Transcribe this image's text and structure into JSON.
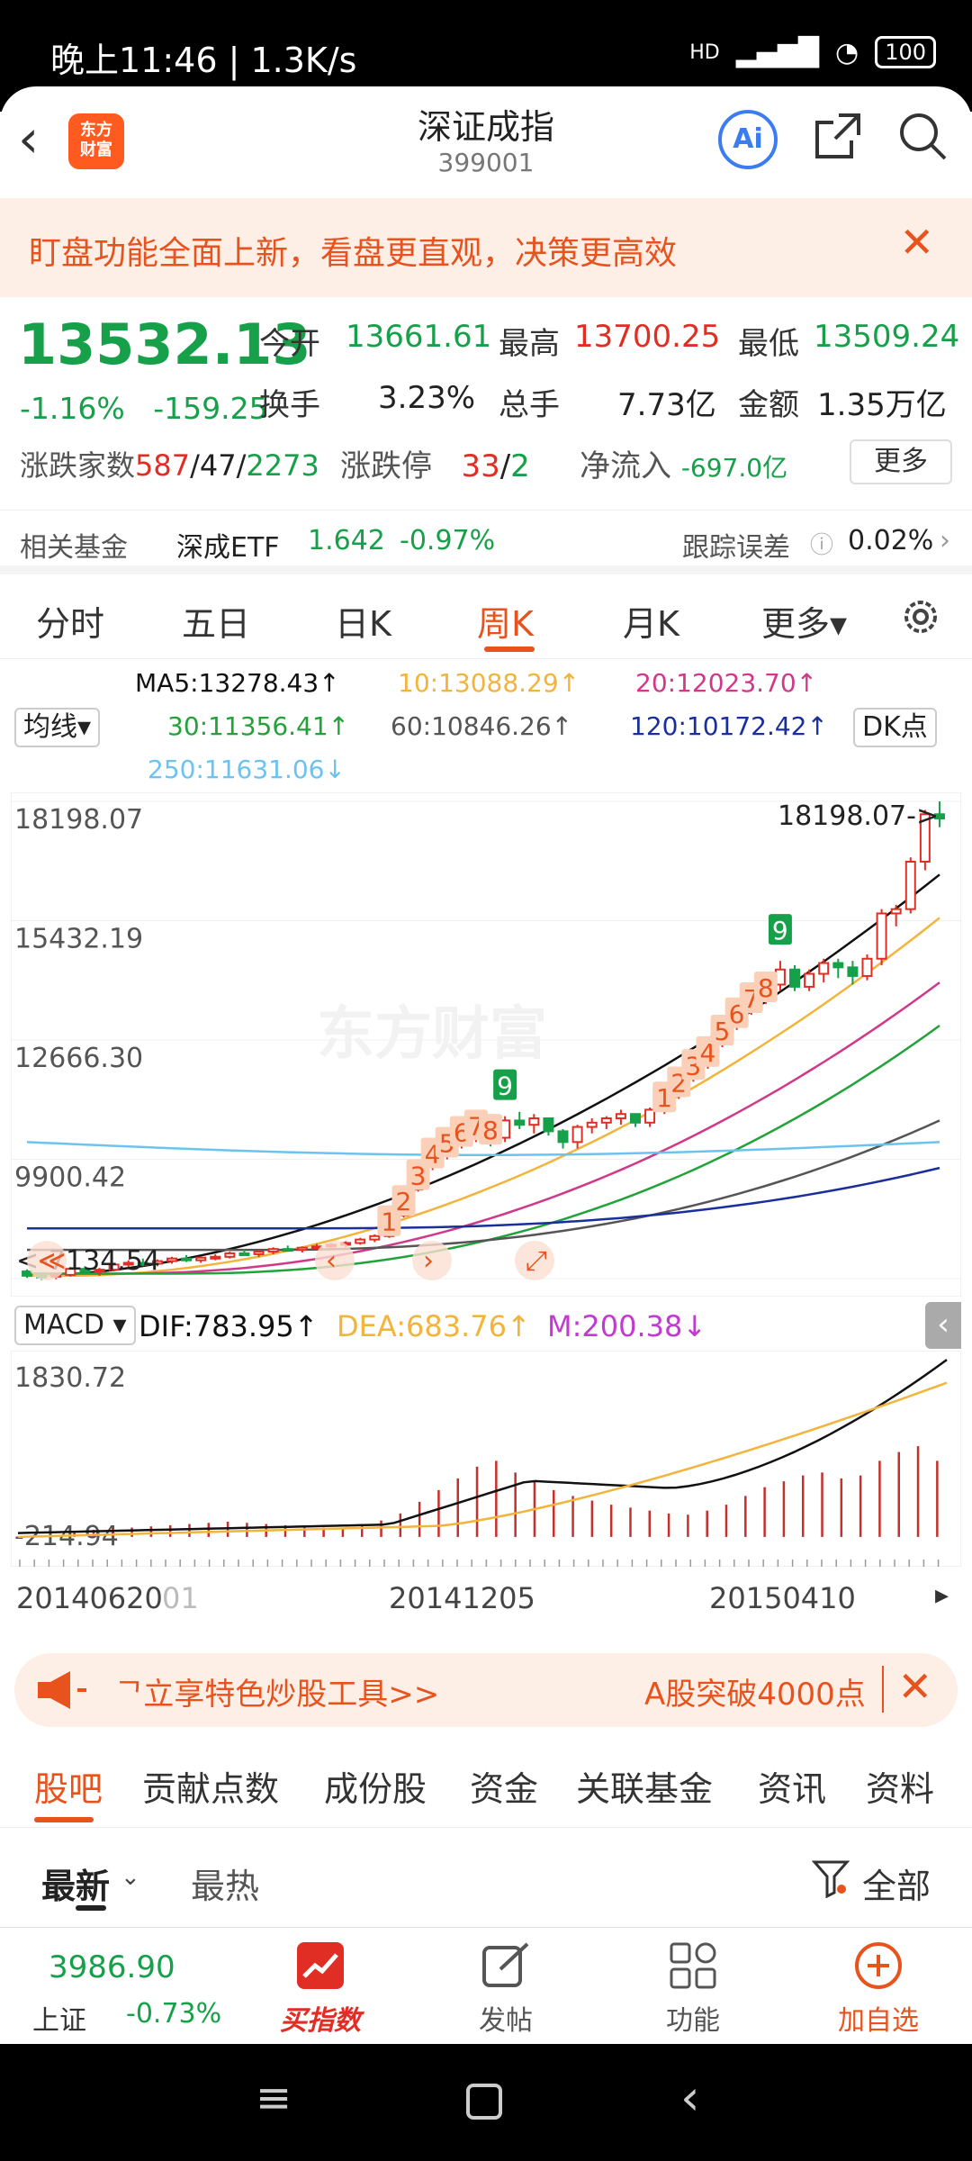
{
  "status_bar": {
    "time": "晚上11:46 | 1.3K/s",
    "battery": "100",
    "net": "HD"
  },
  "header": {
    "back": "‹",
    "logo_text": "东方\n财富",
    "title": "深证成指",
    "code": "399001",
    "ai_label": "Ai"
  },
  "banner": {
    "text": "盯盘功能全面上新，看盘更直观，决策更高效",
    "close": "✕"
  },
  "quote": {
    "price": "13532.13",
    "change_pct": "-1.16%",
    "change_abs": "-159.25",
    "open_label": "今开",
    "open": "13661.61",
    "high_label": "最高",
    "high": "13700.25",
    "low_label": "最低",
    "low": "13509.24",
    "turnover_label": "换手",
    "turnover": "3.23%",
    "volume_label": "总手",
    "volume": "7.73亿",
    "amount_label": "金额",
    "amount": "1.35万亿",
    "breadth_label": "涨跌家数",
    "up_count": "587",
    "sep1": "/",
    "flat_count": "47",
    "sep2": "/",
    "down_count": "2273",
    "limit_label": "涨跌停",
    "limit_up": "33",
    "sep3": "/",
    "limit_down": "2",
    "netflow_label": "净流入",
    "netflow": "-697.0亿",
    "more": "更多"
  },
  "fund": {
    "label": "相关基金",
    "name": "深成ETF",
    "price": "1.642",
    "pct": "-0.97%",
    "err_label": "跟踪误差",
    "err_value": "0.02%"
  },
  "chart_tabs": [
    "分时",
    "五日",
    "日K",
    "周K",
    "月K",
    "更多▾"
  ],
  "ma": {
    "ma_selector": "均线▾",
    "dk_btn": "DK点",
    "ma5": "MA5:13278.43↑",
    "ma10": "10:13088.29↑",
    "ma20": "20:12023.70↑",
    "ma30": "30:11356.41↑",
    "ma60": "60:10846.26↑",
    "ma120": "120:10172.42↑",
    "ma250": "250:11631.06↓"
  },
  "macd": {
    "selector": "MACD ▾",
    "dif": "DIF:783.95↑",
    "dea": "DEA:683.76↑",
    "m": "M:200.38↓",
    "top": "1830.72",
    "bottom": "-214.94"
  },
  "dates": [
    "20140620",
    "01",
    "20141205",
    "20150410"
  ],
  "colors": {
    "up": "#e02e24",
    "down": "#17a04a",
    "accent": "#e8531d",
    "ma5": "#111111",
    "ma10": "#f2b43a",
    "ma20": "#d0388a",
    "ma30": "#23a23a",
    "ma60": "#555555",
    "ma120": "#1a2f9c",
    "ma250": "#6cc3ef"
  },
  "chart_data": {
    "type": "candlestick",
    "y_axis_labels": [
      "18198.07",
      "15432.19",
      "12666.30",
      "9900.42",
      "7134.54"
    ],
    "ylim": [
      7134.54,
      18198.07
    ],
    "max_label": "18198.07->",
    "min_label": "<-7134.54",
    "watermark": "东方财富",
    "x_labels": [
      "20140620",
      "20141205",
      "20150410"
    ],
    "candles": [
      [
        7300,
        7350,
        7150,
        7200
      ],
      [
        7200,
        7280,
        7100,
        7180
      ],
      [
        7180,
        7260,
        7120,
        7220
      ],
      [
        7220,
        7400,
        7180,
        7360
      ],
      [
        7360,
        7420,
        7250,
        7300
      ],
      [
        7300,
        7380,
        7200,
        7340
      ],
      [
        7340,
        7500,
        7300,
        7460
      ],
      [
        7460,
        7560,
        7400,
        7500
      ],
      [
        7500,
        7600,
        7420,
        7480
      ],
      [
        7480,
        7580,
        7420,
        7540
      ],
      [
        7540,
        7640,
        7480,
        7600
      ],
      [
        7600,
        7680,
        7520,
        7560
      ],
      [
        7560,
        7640,
        7500,
        7620
      ],
      [
        7620,
        7700,
        7560,
        7640
      ],
      [
        7640,
        7760,
        7600,
        7720
      ],
      [
        7720,
        7820,
        7660,
        7700
      ],
      [
        7700,
        7800,
        7640,
        7760
      ],
      [
        7760,
        7860,
        7700,
        7820
      ],
      [
        7820,
        7900,
        7760,
        7800
      ],
      [
        7800,
        7880,
        7740,
        7850
      ],
      [
        7850,
        7940,
        7800,
        7880
      ],
      [
        7880,
        7960,
        7820,
        7920
      ],
      [
        7920,
        8000,
        7860,
        7960
      ],
      [
        7960,
        8080,
        7920,
        8040
      ],
      [
        8040,
        8160,
        7980,
        8120
      ],
      [
        8120,
        8650,
        8080,
        8600
      ],
      [
        8600,
        9250,
        8550,
        9200
      ],
      [
        9200,
        9850,
        9150,
        9800
      ],
      [
        9800,
        10100,
        9650,
        10000
      ],
      [
        10000,
        10400,
        9900,
        10300
      ],
      [
        10300,
        10600,
        10150,
        10450
      ],
      [
        10450,
        10750,
        10300,
        10600
      ],
      [
        10600,
        10500,
        10200,
        10400
      ],
      [
        10400,
        10900,
        10300,
        10800
      ],
      [
        10800,
        11000,
        10600,
        10700
      ],
      [
        10700,
        10950,
        10500,
        10850
      ],
      [
        10850,
        10700,
        10450,
        10550
      ],
      [
        10550,
        10600,
        10150,
        10300
      ],
      [
        10300,
        10700,
        10150,
        10650
      ],
      [
        10650,
        10850,
        10500,
        10750
      ],
      [
        10750,
        10900,
        10600,
        10850
      ],
      [
        10850,
        11050,
        10700,
        10950
      ],
      [
        10950,
        10850,
        10650,
        10750
      ],
      [
        10750,
        11100,
        10650,
        11050
      ],
      [
        11050,
        11500,
        10950,
        11400
      ],
      [
        11400,
        11900,
        11300,
        11800
      ],
      [
        11800,
        12200,
        11700,
        12100
      ],
      [
        12100,
        12700,
        12000,
        12600
      ],
      [
        12600,
        13100,
        12500,
        13000
      ],
      [
        13000,
        13500,
        12900,
        13400
      ],
      [
        13400,
        13900,
        13250,
        13700
      ],
      [
        13700,
        14100,
        13500,
        13950
      ],
      [
        13950,
        14500,
        13800,
        14300
      ],
      [
        14300,
        14400,
        13800,
        13900
      ],
      [
        13900,
        14300,
        13800,
        14200
      ],
      [
        14200,
        14550,
        14000,
        14450
      ],
      [
        14450,
        14550,
        14100,
        14350
      ],
      [
        14350,
        14500,
        13950,
        14150
      ],
      [
        14150,
        14650,
        14050,
        14550
      ],
      [
        14550,
        15700,
        14400,
        15600
      ],
      [
        15600,
        15800,
        15300,
        15700
      ],
      [
        15700,
        16900,
        15600,
        16800
      ],
      [
        16800,
        18000,
        16600,
        17900
      ],
      [
        17900,
        18198,
        17600,
        17800
      ]
    ],
    "ma_series": [
      {
        "name": "MA5",
        "values_start": 7200,
        "values_end": 16500
      },
      {
        "name": "MA10",
        "values_start": 7200,
        "values_end": 15500
      },
      {
        "name": "MA20",
        "values_start": 7250,
        "values_end": 14000
      },
      {
        "name": "MA30",
        "values_start": 7250,
        "values_end": 13000
      },
      {
        "name": "MA60",
        "values_start": 7800,
        "values_end": 10800
      },
      {
        "name": "MA120",
        "values_start": 8300,
        "values_end": 9700
      },
      {
        "name": "MA250",
        "values_start": 10300,
        "values_end": 10300
      }
    ],
    "td_labels_up": [
      {
        "i": 25,
        "t": "1"
      },
      {
        "i": 26,
        "t": "2"
      },
      {
        "i": 27,
        "t": "3"
      },
      {
        "i": 28,
        "t": "4"
      },
      {
        "i": 29,
        "t": "5"
      },
      {
        "i": 30,
        "t": "6"
      },
      {
        "i": 31,
        "t": "7"
      },
      {
        "i": 32,
        "t": "8"
      },
      {
        "i": 44,
        "t": "1"
      },
      {
        "i": 45,
        "t": "2"
      },
      {
        "i": 46,
        "t": "3"
      },
      {
        "i": 47,
        "t": "4"
      },
      {
        "i": 48,
        "t": "5"
      },
      {
        "i": 49,
        "t": "6"
      },
      {
        "i": 50,
        "t": "7"
      },
      {
        "i": 51,
        "t": "8"
      }
    ],
    "td_labels_down": [
      {
        "i": 33,
        "t": "9"
      },
      {
        "i": 52,
        "t": "9"
      }
    ],
    "macd_hist": [
      10,
      12,
      14,
      16,
      18,
      20,
      22,
      24,
      26,
      24,
      22,
      20,
      18,
      16,
      14,
      20,
      28,
      40,
      60,
      80,
      100,
      120,
      130,
      110,
      95,
      80,
      70,
      62,
      55,
      50,
      45,
      40,
      38,
      45,
      55,
      70,
      85,
      95,
      105,
      110,
      100,
      105,
      130,
      145,
      155,
      130
    ],
    "macd_dif_end": 1830,
    "macd_ylim": [
      -214.94,
      1830.72
    ]
  },
  "promo": {
    "text": "ᄀ立享特色炒股工具>>",
    "right": "A股突破4000点",
    "close": "✕"
  },
  "sub_tabs": [
    "股吧",
    "贡献点数",
    "成份股",
    "资金",
    "关联基金",
    "资讯",
    "资料"
  ],
  "sort": {
    "latest": "最新",
    "hot": "最热",
    "filter": "全部"
  },
  "toolbar": {
    "index_value": "3986.90",
    "index_name": "上证",
    "index_pct": "-0.73%",
    "buy": "买指数",
    "post": "发帖",
    "func": "功能",
    "add": "加自选"
  }
}
